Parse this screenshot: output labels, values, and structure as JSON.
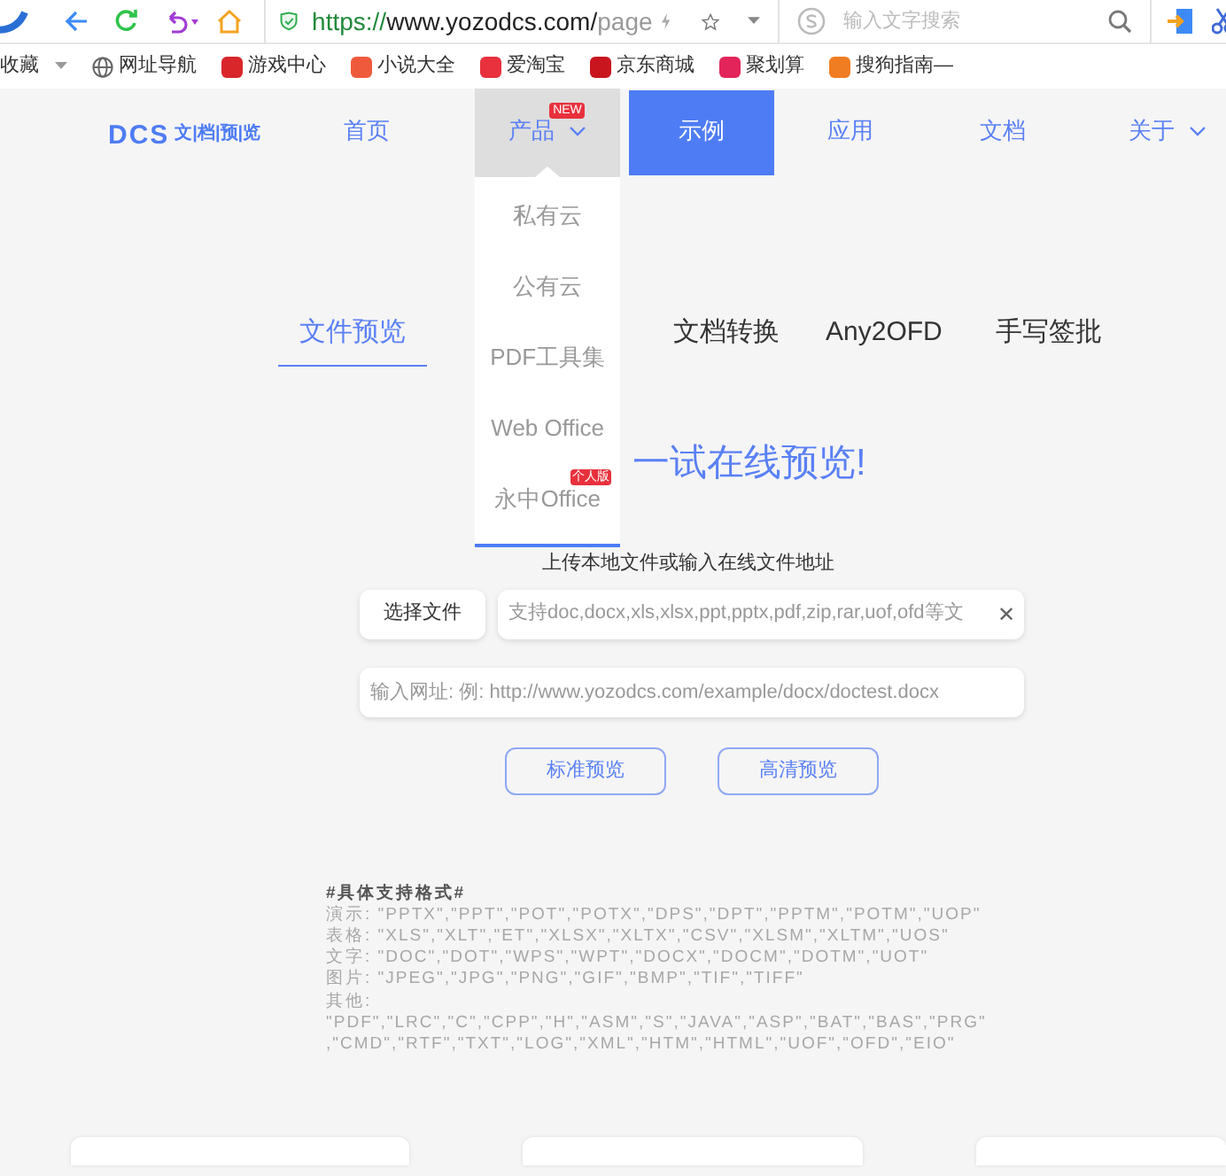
{
  "browser": {
    "url_scheme": "https://",
    "url_host": "www.yozodcs.com/",
    "url_path": "page",
    "search_placeholder": "输入文字搜索",
    "bookmarks": [
      {
        "label": "收藏",
        "kind": "menu"
      },
      {
        "label": "网址导航",
        "kind": "globe",
        "color": "#666666"
      },
      {
        "label": "游戏中心",
        "kind": "badge",
        "color": "#d9262b"
      },
      {
        "label": "小说大全",
        "kind": "badge",
        "color": "#f05a3c"
      },
      {
        "label": "爱淘宝",
        "kind": "badge",
        "color": "#e8313d"
      },
      {
        "label": "京东商城",
        "kind": "badge",
        "color": "#c9151e"
      },
      {
        "label": "聚划算",
        "kind": "badge",
        "color": "#e3245a"
      },
      {
        "label": "搜狗指南—",
        "kind": "badge",
        "color": "#f07d22"
      }
    ]
  },
  "nav": {
    "logo": "DCS",
    "logo_sub": "文|档|预|览",
    "items": [
      {
        "label": "首页",
        "selected": false,
        "hover": false,
        "dropdown": false
      },
      {
        "label": "产品",
        "selected": false,
        "hover": true,
        "dropdown": true,
        "badge": "NEW"
      },
      {
        "label": "示例",
        "selected": true,
        "hover": false,
        "dropdown": false
      },
      {
        "label": "应用",
        "selected": false,
        "hover": false,
        "dropdown": false
      },
      {
        "label": "文档",
        "selected": false,
        "hover": false,
        "dropdown": false
      },
      {
        "label": "关于",
        "selected": false,
        "hover": false,
        "dropdown": true
      }
    ],
    "menu": [
      {
        "label": "私有云"
      },
      {
        "label": "公有云"
      },
      {
        "label": "PDF工具集"
      },
      {
        "label": "Web Office"
      },
      {
        "label": "永中Office",
        "badge": "个人版"
      }
    ]
  },
  "tabs": [
    {
      "label": "文件预览",
      "selected": true
    },
    {
      "label": "文档转换",
      "selected": false
    },
    {
      "label": "Any2OFD",
      "selected": false
    },
    {
      "label": "手写签批",
      "selected": false
    }
  ],
  "heading": "一试在线预览!",
  "subtitle": "上传本地文件或输入在线文件地址",
  "choose_file": "选择文件",
  "file_placeholder": "支持doc,docx,xls,xlsx,ppt,pptx,pdf,zip,rar,uof,ofd等文",
  "clear": "✕",
  "url_placeholder": "输入网址: 例: http://www.yozodcs.com/example/docx/doctest.docx",
  "buttons": [
    "标准预览",
    "高清预览"
  ],
  "formats_title": "#具体支持格式#",
  "formats": [
    "演示: \"PPTX\",\"PPT\",\"POT\",\"POTX\",\"DPS\",\"DPT\",\"PPTM\",\"POTM\",\"UOP\"",
    "表格: \"XLS\",\"XLT\",\"ET\",\"XLSX\",\"XLTX\",\"CSV\",\"XLSM\",\"XLTM\",\"UOS\"",
    "文字: \"DOC\",\"DOT\",\"WPS\",\"WPT\",\"DOCX\",\"DOCM\",\"DOTM\",\"UOT\"",
    "图片: \"JPEG\",\"JPG\",\"PNG\",\"GIF\",\"BMP\",\"TIF\",\"TIFF\"",
    "其他:",
    "\"PDF\",\"LRC\",\"C\",\"CPP\",\"H\",\"ASM\",\"S\",\"JAVA\",\"ASP\",\"BAT\",\"BAS\",\"PRG\"",
    ",\"CMD\",\"RTF\",\"TXT\",\"LOG\",\"XML\",\"HTM\",\"HTML\",\"UOF\",\"OFD\",\"EIO\""
  ]
}
